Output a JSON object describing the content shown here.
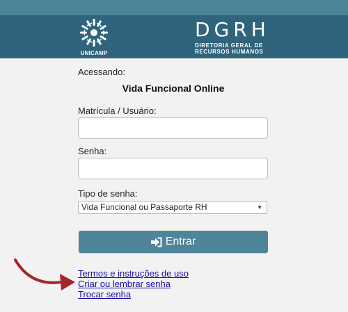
{
  "header": {
    "logo_text": "UNICAMP",
    "dgrh_title": "DGRH",
    "dgrh_subtitle_line1": "DIRETORIA GERAL DE",
    "dgrh_subtitle_line2": "RECURSOS HUMANOS"
  },
  "form": {
    "accessing_label": "Acessando:",
    "system_name": "Vida Funcional Online",
    "user_label": "Matrícula / Usuário:",
    "user_value": "",
    "password_label": "Senha:",
    "password_value": "",
    "password_type_label": "Tipo de senha:",
    "password_type_selected": "Vida Funcional ou Passaporte RH",
    "submit_label": "Entrar"
  },
  "links": {
    "terms": "Termos e instruções de uso",
    "create": "Criar ou lembrar senha",
    "change": "Trocar senha"
  },
  "colors": {
    "header_dark": "#2f647c",
    "header_light": "#4e8499",
    "button": "#4f8499",
    "annotation_arrow": "#a3262b",
    "link": "#1a0dab"
  },
  "icons": {
    "submit": "sign-in-icon",
    "logo": "unicamp-logo",
    "annotation": "curved-arrow-icon"
  }
}
